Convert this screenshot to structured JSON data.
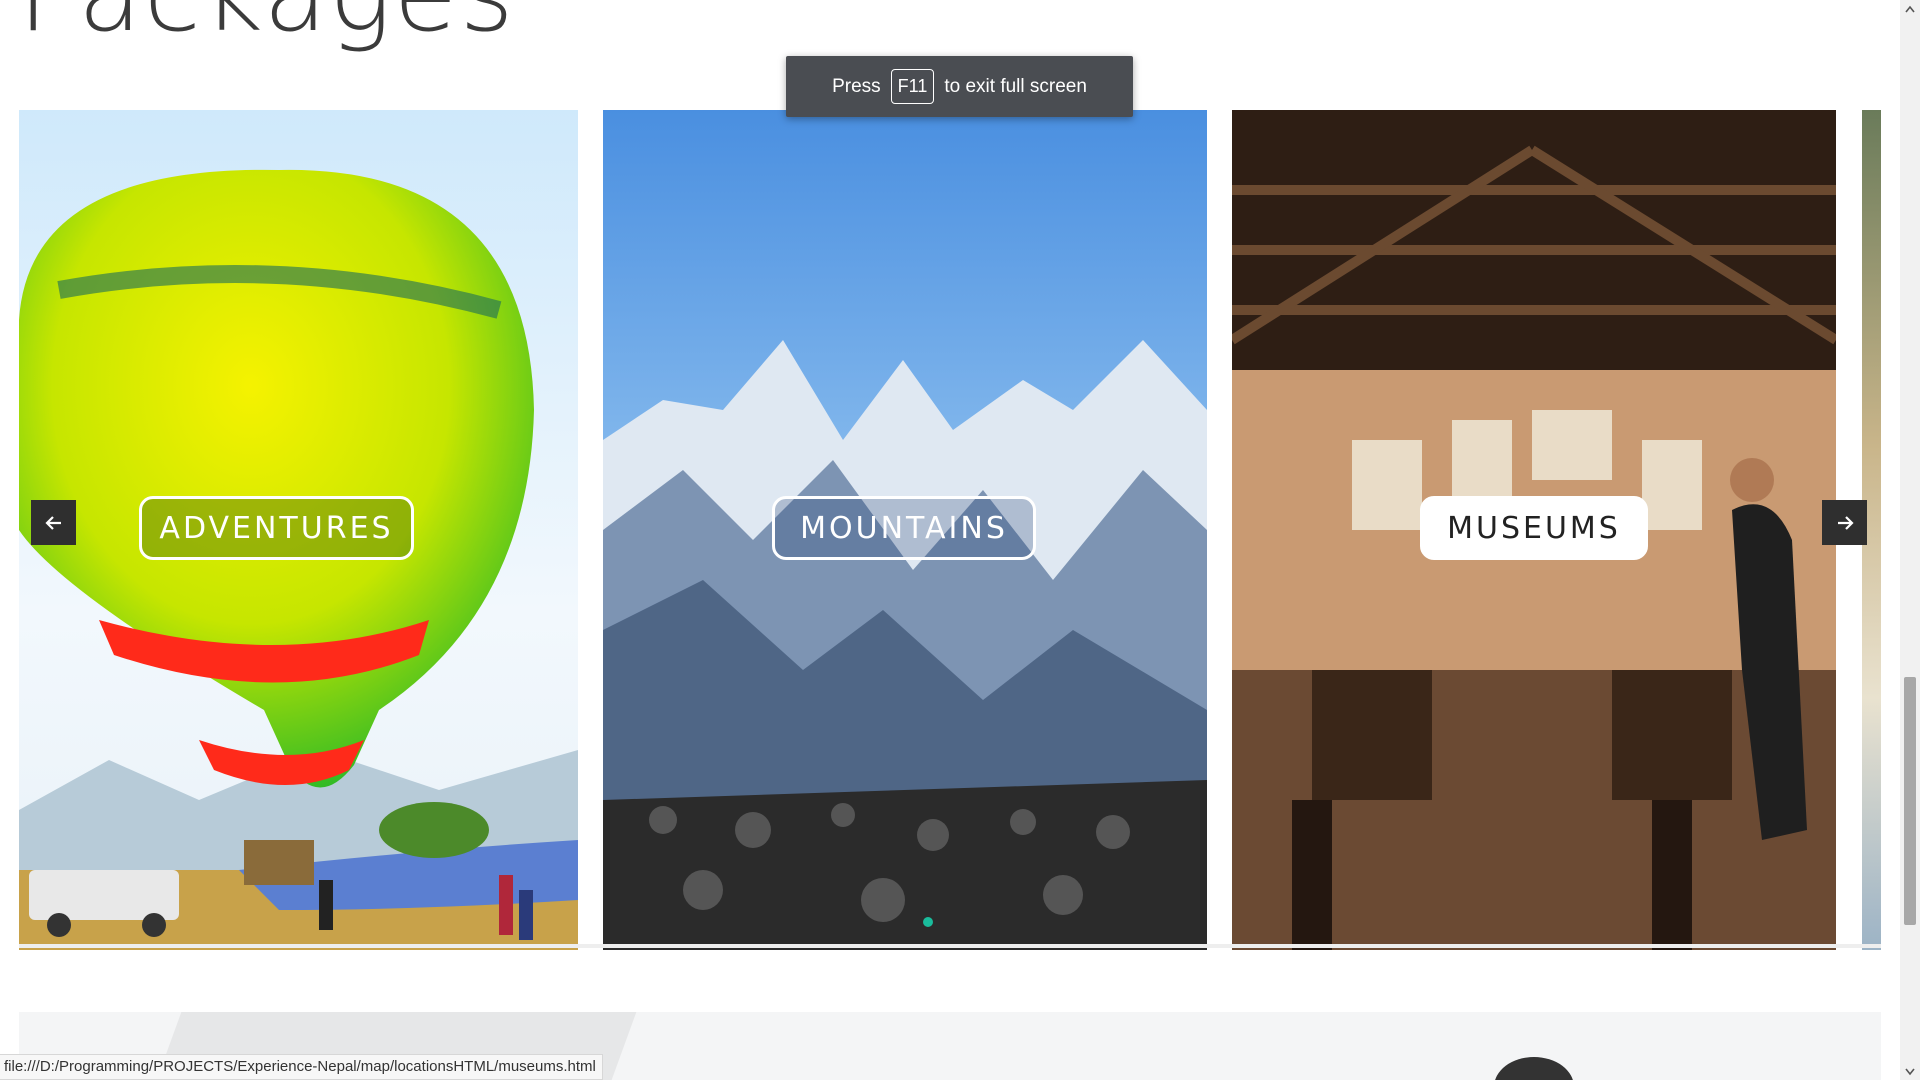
{
  "section": {
    "title": "Packages"
  },
  "fullscreen_toast": {
    "prefix": "Press",
    "key": "F11",
    "suffix": "to exit full screen"
  },
  "carousel": {
    "cards": [
      {
        "label": "ADVENTURES",
        "image": "hot-air-balloon"
      },
      {
        "label": "MOUNTAINS",
        "image": "snowy-mountains"
      },
      {
        "label": "MUSEUMS",
        "image": "museum-interior"
      }
    ],
    "prev_icon": "arrow-left-icon",
    "next_icon": "arrow-right-icon",
    "accent": "#1abc9c"
  },
  "status_bar": {
    "url": "file:///D:/Programming/PROJECTS/Experience-Nepal/map/locationsHTML/museums.html"
  },
  "colors": {
    "toast_bg": "#4a4d52",
    "nav_bg": "#2f2f2f",
    "title": "#3b3b3b"
  }
}
